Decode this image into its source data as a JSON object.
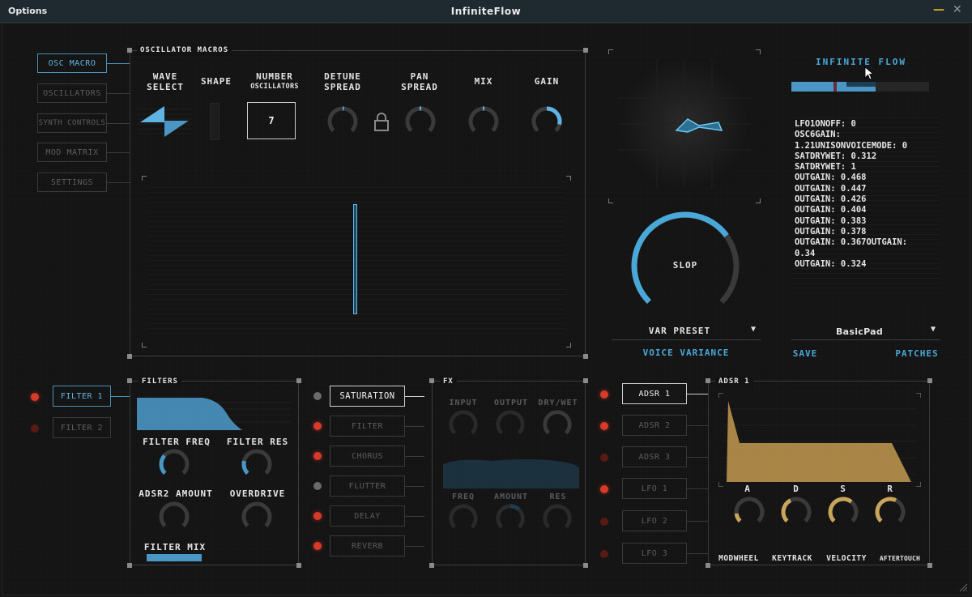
{
  "window": {
    "menu_label": "Options",
    "title": "InfiniteFlow"
  },
  "nav": [
    "OSC MACRO",
    "OSCILLATORS",
    "SYNTH CONTROLS",
    "MOD MATRIX",
    "SETTINGS"
  ],
  "osc_macros": {
    "title": "OSCILLATOR MACROS",
    "wave_select": "WAVE\nSELECT",
    "shape": "SHAPE",
    "number_osc": "NUMBER",
    "number_osc_sub": "OSCILLATORS",
    "number_value": "7",
    "detune": "DETUNE\nSPREAD",
    "pan": "PAN\nSPREAD",
    "mix": "MIX",
    "gain": "GAIN"
  },
  "voice": {
    "slop_label": "SLOP",
    "slop_value": 0.7,
    "preset": "VAR PRESET",
    "caption": "VOICE VARIANCE"
  },
  "infinite": {
    "title": "INFINITE FLOW",
    "log": "LFO1ONOFF: 0\nOSC6GAIN:\n1.21UNISONVOICEMODE: 0\nSATDRYWET: 0.312\nSATDRYWET: 1\nOUTGAIN: 0.468\nOUTGAIN: 0.447\nOUTGAIN: 0.426\nOUTGAIN: 0.404\nOUTGAIN: 0.383\nOUTGAIN: 0.378\nOUTGAIN: 0.367OUTGAIN:\n0.34\nOUTGAIN: 0.324",
    "patch": "BasicPad",
    "save": "SAVE",
    "patches": "PATCHES"
  },
  "filters": {
    "tabs": [
      "FILTER 1",
      "FILTER 2"
    ],
    "title": "FILTERS",
    "freq": "FILTER FREQ",
    "res": "FILTER RES",
    "adsr2": "ADSR2 AMOUNT",
    "overdrive": "OVERDRIVE",
    "mix": "FILTER MIX"
  },
  "fx": {
    "buttons": [
      "SATURATION",
      "FILTER",
      "CHORUS",
      "FLUTTER",
      "DELAY",
      "REVERB"
    ],
    "title": "FX",
    "top_knobs": [
      "INPUT",
      "OUTPUT",
      "DRY/WET"
    ],
    "bottom_knobs": [
      "FREQ",
      "AMOUNT",
      "RES"
    ]
  },
  "envelopes": {
    "buttons": [
      "ADSR 1",
      "ADSR 2",
      "ADSR 3",
      "LFO 1",
      "LFO 2",
      "LFO 3"
    ],
    "title": "ADSR 1",
    "knobs": [
      "A",
      "D",
      "S",
      "R"
    ],
    "mods": [
      "MODWHEEL",
      "KEYTRACK",
      "VELOCITY",
      "AFTERTOUCH"
    ]
  },
  "colors": {
    "accent_blue": "#4aa8d8",
    "accent_gold": "#c9a55c",
    "led_red": "#d83a2a"
  },
  "icons": [
    "lock-icon",
    "wave-select-icon",
    "dropdown-arrow-icon",
    "minimize-icon",
    "close-icon"
  ]
}
